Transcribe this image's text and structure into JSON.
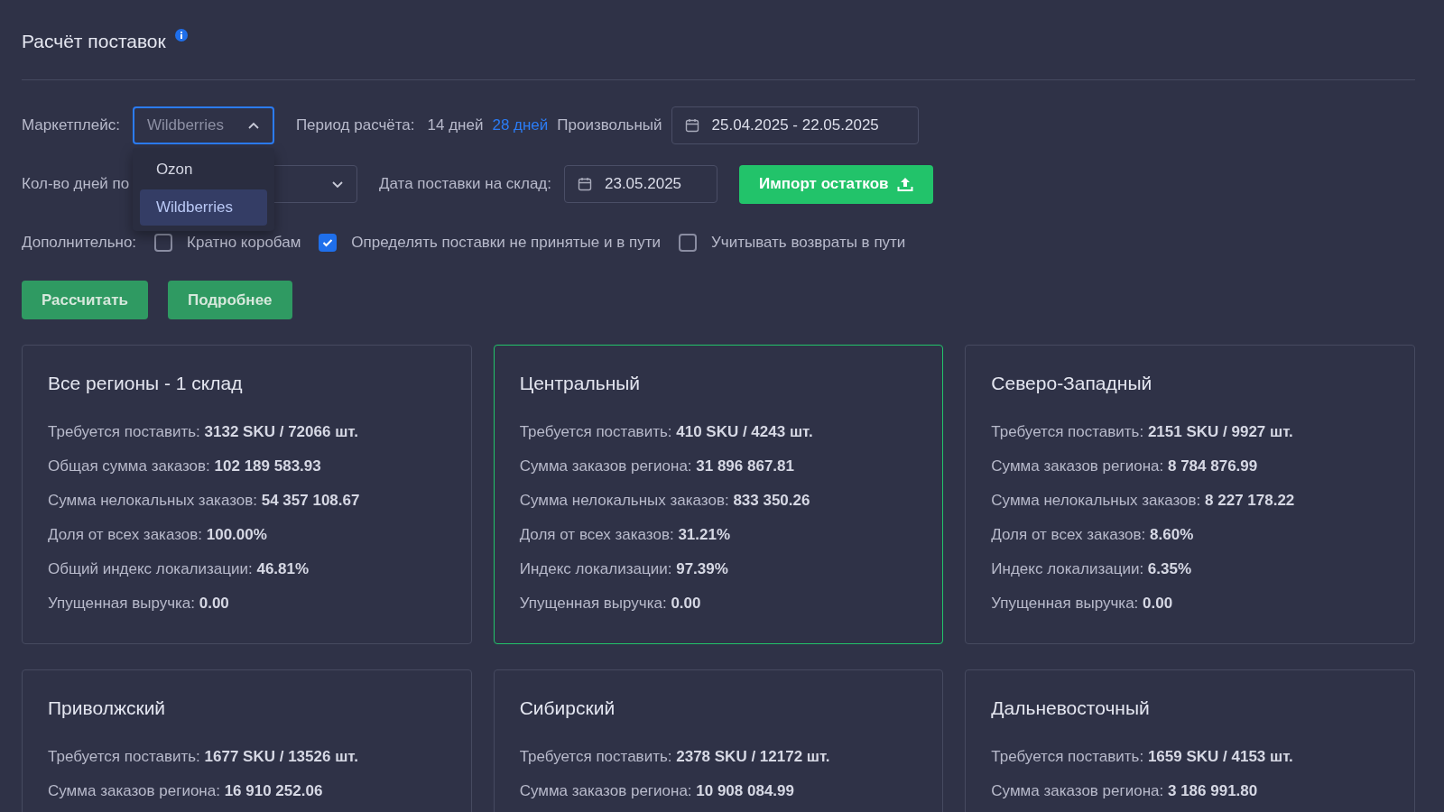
{
  "title": "Расчёт поставок",
  "marketplace": {
    "label": "Маркетплейс:",
    "value": "Wildberries",
    "expanded": true,
    "options": [
      {
        "label": "Ozon",
        "selected": false
      },
      {
        "label": "Wildberries",
        "selected": true
      }
    ]
  },
  "period": {
    "label": "Период расчёта:",
    "options": [
      {
        "label": "14 дней",
        "selected": false
      },
      {
        "label": "28 дней",
        "selected": true
      },
      {
        "label": "Произвольный",
        "selected": false
      }
    ],
    "range": "25.04.2025 - 22.05.2025"
  },
  "days": {
    "label": "Кол-во дней по"
  },
  "delivery_date": {
    "label": "Дата поставки на склад:",
    "value": "23.05.2025"
  },
  "import_button": "Импорт остатков",
  "extra": {
    "label": "Дополнительно:",
    "options": [
      {
        "label": "Кратно коробам",
        "checked": false
      },
      {
        "label": "Определять поставки не принятые и в пути",
        "checked": true
      },
      {
        "label": "Учитывать возвраты в пути",
        "checked": false
      }
    ]
  },
  "buttons": [
    "Рассчитать",
    "Подробнее"
  ],
  "cards": [
    {
      "title": "Все регионы - 1 склад",
      "selected": false,
      "lines": [
        {
          "label": "Требуется поставить:",
          "value": "3132 SKU / 72066 шт."
        },
        {
          "label": "Общая сумма заказов:",
          "value": "102 189 583.93"
        },
        {
          "label": "Сумма нелокальных заказов:",
          "value": "54 357 108.67"
        },
        {
          "label": "Доля от всех заказов:",
          "value": "100.00%"
        },
        {
          "label": "Общий индекс локализации:",
          "value": "46.81%"
        },
        {
          "label": "Упущенная выручка:",
          "value": "0.00"
        }
      ]
    },
    {
      "title": "Центральный",
      "selected": true,
      "lines": [
        {
          "label": "Требуется поставить:",
          "value": "410 SKU / 4243 шт."
        },
        {
          "label": "Сумма заказов региона:",
          "value": "31 896 867.81"
        },
        {
          "label": "Сумма нелокальных заказов:",
          "value": "833 350.26"
        },
        {
          "label": "Доля от всех заказов:",
          "value": "31.21%"
        },
        {
          "label": "Индекс локализации:",
          "value": "97.39%"
        },
        {
          "label": "Упущенная выручка:",
          "value": "0.00"
        }
      ]
    },
    {
      "title": "Северо-Западный",
      "selected": false,
      "lines": [
        {
          "label": "Требуется поставить:",
          "value": "2151 SKU / 9927 шт."
        },
        {
          "label": "Сумма заказов региона:",
          "value": "8 784 876.99"
        },
        {
          "label": "Сумма нелокальных заказов:",
          "value": "8 227 178.22"
        },
        {
          "label": "Доля от всех заказов:",
          "value": "8.60%"
        },
        {
          "label": "Индекс локализации:",
          "value": "6.35%"
        },
        {
          "label": "Упущенная выручка:",
          "value": "0.00"
        }
      ]
    },
    {
      "title": "Приволжский",
      "selected": false,
      "lines": [
        {
          "label": "Требуется поставить:",
          "value": "1677 SKU / 13526 шт."
        },
        {
          "label": "Сумма заказов региона:",
          "value": "16 910 252.06"
        }
      ]
    },
    {
      "title": "Сибирский",
      "selected": false,
      "lines": [
        {
          "label": "Требуется поставить:",
          "value": "2378 SKU / 12172 шт."
        },
        {
          "label": "Сумма заказов региона:",
          "value": "10 908 084.99"
        }
      ]
    },
    {
      "title": "Дальневосточный",
      "selected": false,
      "lines": [
        {
          "label": "Требуется поставить:",
          "value": "1659 SKU / 4153 шт."
        },
        {
          "label": "Сумма заказов региона:",
          "value": "3 186 991.80"
        }
      ]
    }
  ]
}
